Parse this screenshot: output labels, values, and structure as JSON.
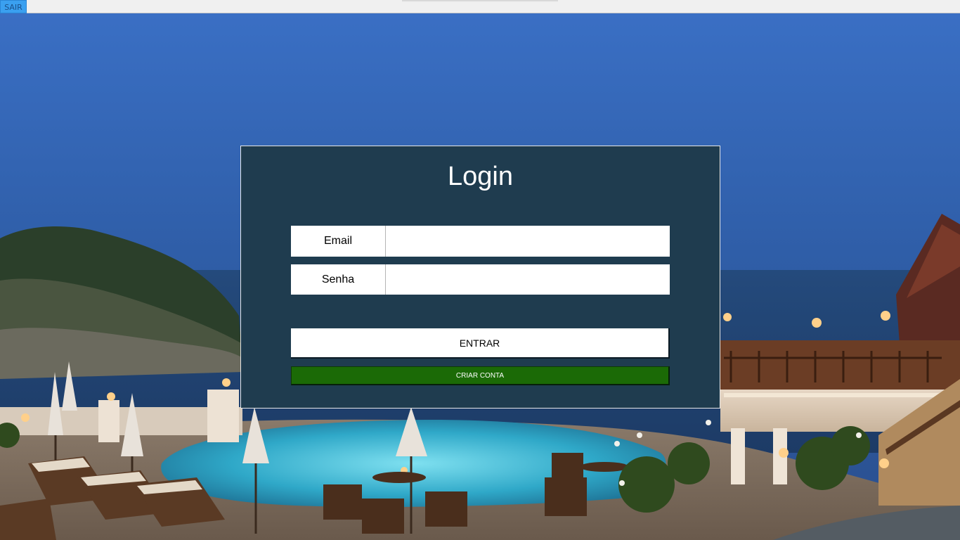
{
  "toolbar": {
    "exit_label": "SAIR"
  },
  "login": {
    "title": "Login",
    "email_label": "Email",
    "email_value": "",
    "password_label": "Senha",
    "password_value": "",
    "enter_label": "ENTRAR",
    "create_account_label": "CRIAR CONTA"
  },
  "colors": {
    "panel": "#1f3c4f",
    "create_button": "#1b6a06",
    "exit_button": "#3aa0f0"
  },
  "background": {
    "description_icon": "resort-pool-sunset-photo"
  }
}
